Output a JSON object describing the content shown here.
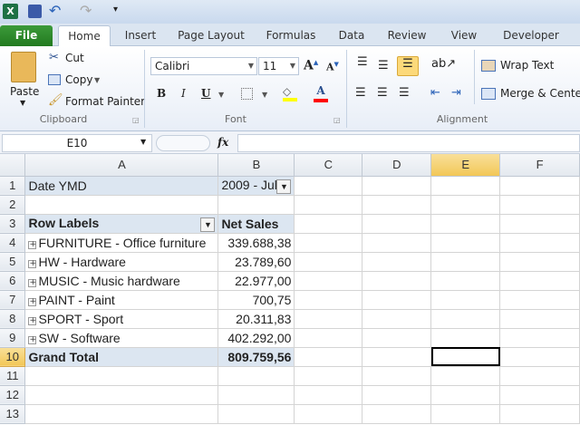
{
  "quick_access": {
    "app_icon": "excel-icon",
    "save": "save-icon",
    "undo": "undo-icon",
    "redo": "redo-icon",
    "customize": "customize-icon"
  },
  "tabs": [
    "File",
    "Home",
    "Insert",
    "Page Layout",
    "Formulas",
    "Data",
    "Review",
    "View",
    "Developer"
  ],
  "clipboard": {
    "paste": "Paste",
    "cut": "Cut",
    "copy": "Copy",
    "format_painter": "Format Painter",
    "label": "Clipboard"
  },
  "font": {
    "name": "Calibri",
    "size": "11",
    "bold": "B",
    "italic": "I",
    "underline": "U",
    "label": "Font",
    "fill_color": "#ffff00",
    "font_color": "#ff0000"
  },
  "alignment": {
    "wrap_text": "Wrap Text",
    "merge_center": "Merge & Center",
    "label": "Alignment"
  },
  "formula_bar": {
    "name_box": "E10",
    "fx": "fx",
    "value": ""
  },
  "columns": [
    "A",
    "B",
    "C",
    "D",
    "E",
    "F"
  ],
  "rows": [
    "1",
    "2",
    "3",
    "4",
    "5",
    "6",
    "7",
    "8",
    "9",
    "10",
    "11",
    "12",
    "13"
  ],
  "selected_cell": "E10",
  "pivot": {
    "filter_label": "Date YMD",
    "filter_value": "2009 - Jul",
    "row_labels_header": "Row Labels",
    "value_header": "Net Sales",
    "items": [
      {
        "label": "FURNITURE - Office furniture",
        "value": "339.688,38"
      },
      {
        "label": "HW - Hardware",
        "value": "23.789,60"
      },
      {
        "label": "MUSIC - Music hardware",
        "value": "22.977,00"
      },
      {
        "label": "PAINT - Paint",
        "value": "700,75"
      },
      {
        "label": "SPORT - Sport",
        "value": "20.311,83"
      },
      {
        "label": "SW - Software",
        "value": "402.292,00"
      }
    ],
    "grand_total_label": "Grand Total",
    "grand_total_value": "809.759,56"
  }
}
